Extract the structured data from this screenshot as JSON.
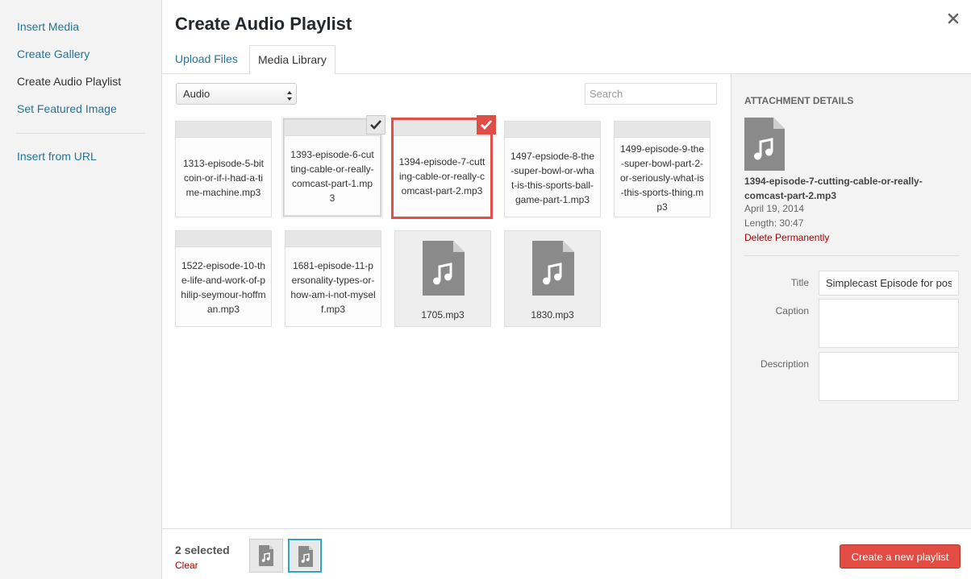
{
  "menu": {
    "items": [
      {
        "label": "Insert Media"
      },
      {
        "label": "Create Gallery"
      },
      {
        "label": "Create Audio Playlist"
      },
      {
        "label": "Set Featured Image"
      },
      {
        "label": "Insert from URL"
      }
    ]
  },
  "frame": {
    "title": "Create Audio Playlist",
    "close_icon": "close-icon"
  },
  "tabs": [
    {
      "label": "Upload Files"
    },
    {
      "label": "Media Library"
    }
  ],
  "filters": {
    "type_selected": "Audio",
    "search_placeholder": "Search"
  },
  "attachments": [
    {
      "filename": "1313-episode-5-bitcoin-or-if-i-had-a-time-machine.mp3"
    },
    {
      "filename": "1393-episode-6-cutting-cable-or-really-comcast-part-1.mp3"
    },
    {
      "filename": "1394-episode-7-cutting-cable-or-really-comcast-part-2.mp3"
    },
    {
      "filename": "1497-epsiode-8-the-super-bowl-or-what-is-this-sports-ball-game-part-1.mp3"
    },
    {
      "filename": "1499-episode-9-the-super-bowl-part-2-or-seriously-what-is-this-sports-thing.mp3"
    },
    {
      "filename": "1522-episode-10-the-life-and-work-of-philip-seymour-hoffman.mp3"
    },
    {
      "filename": "1681-episode-11-personality-types-or-how-am-i-not-myself.mp3"
    },
    {
      "filename": "1705.mp3"
    },
    {
      "filename": "1830.mp3"
    }
  ],
  "details": {
    "heading": "ATTACHMENT DETAILS",
    "filename": "1394-episode-7-cutting-cable-or-really-comcast-part-2.mp3",
    "date": "April 19, 2014",
    "length": "Length: 30:47",
    "delete_label": "Delete Permanently",
    "title_label": "Title",
    "title_value": "Simplecast Episode for post",
    "caption_label": "Caption",
    "caption_value": "",
    "description_label": "Description",
    "description_value": ""
  },
  "toolbar": {
    "selected_count": "2 selected",
    "clear_label": "Clear",
    "primary_label": "Create a new playlist"
  },
  "colors": {
    "accent_red": "#e14d43",
    "link_blue": "#21759b",
    "delete_red": "#aa0000"
  }
}
